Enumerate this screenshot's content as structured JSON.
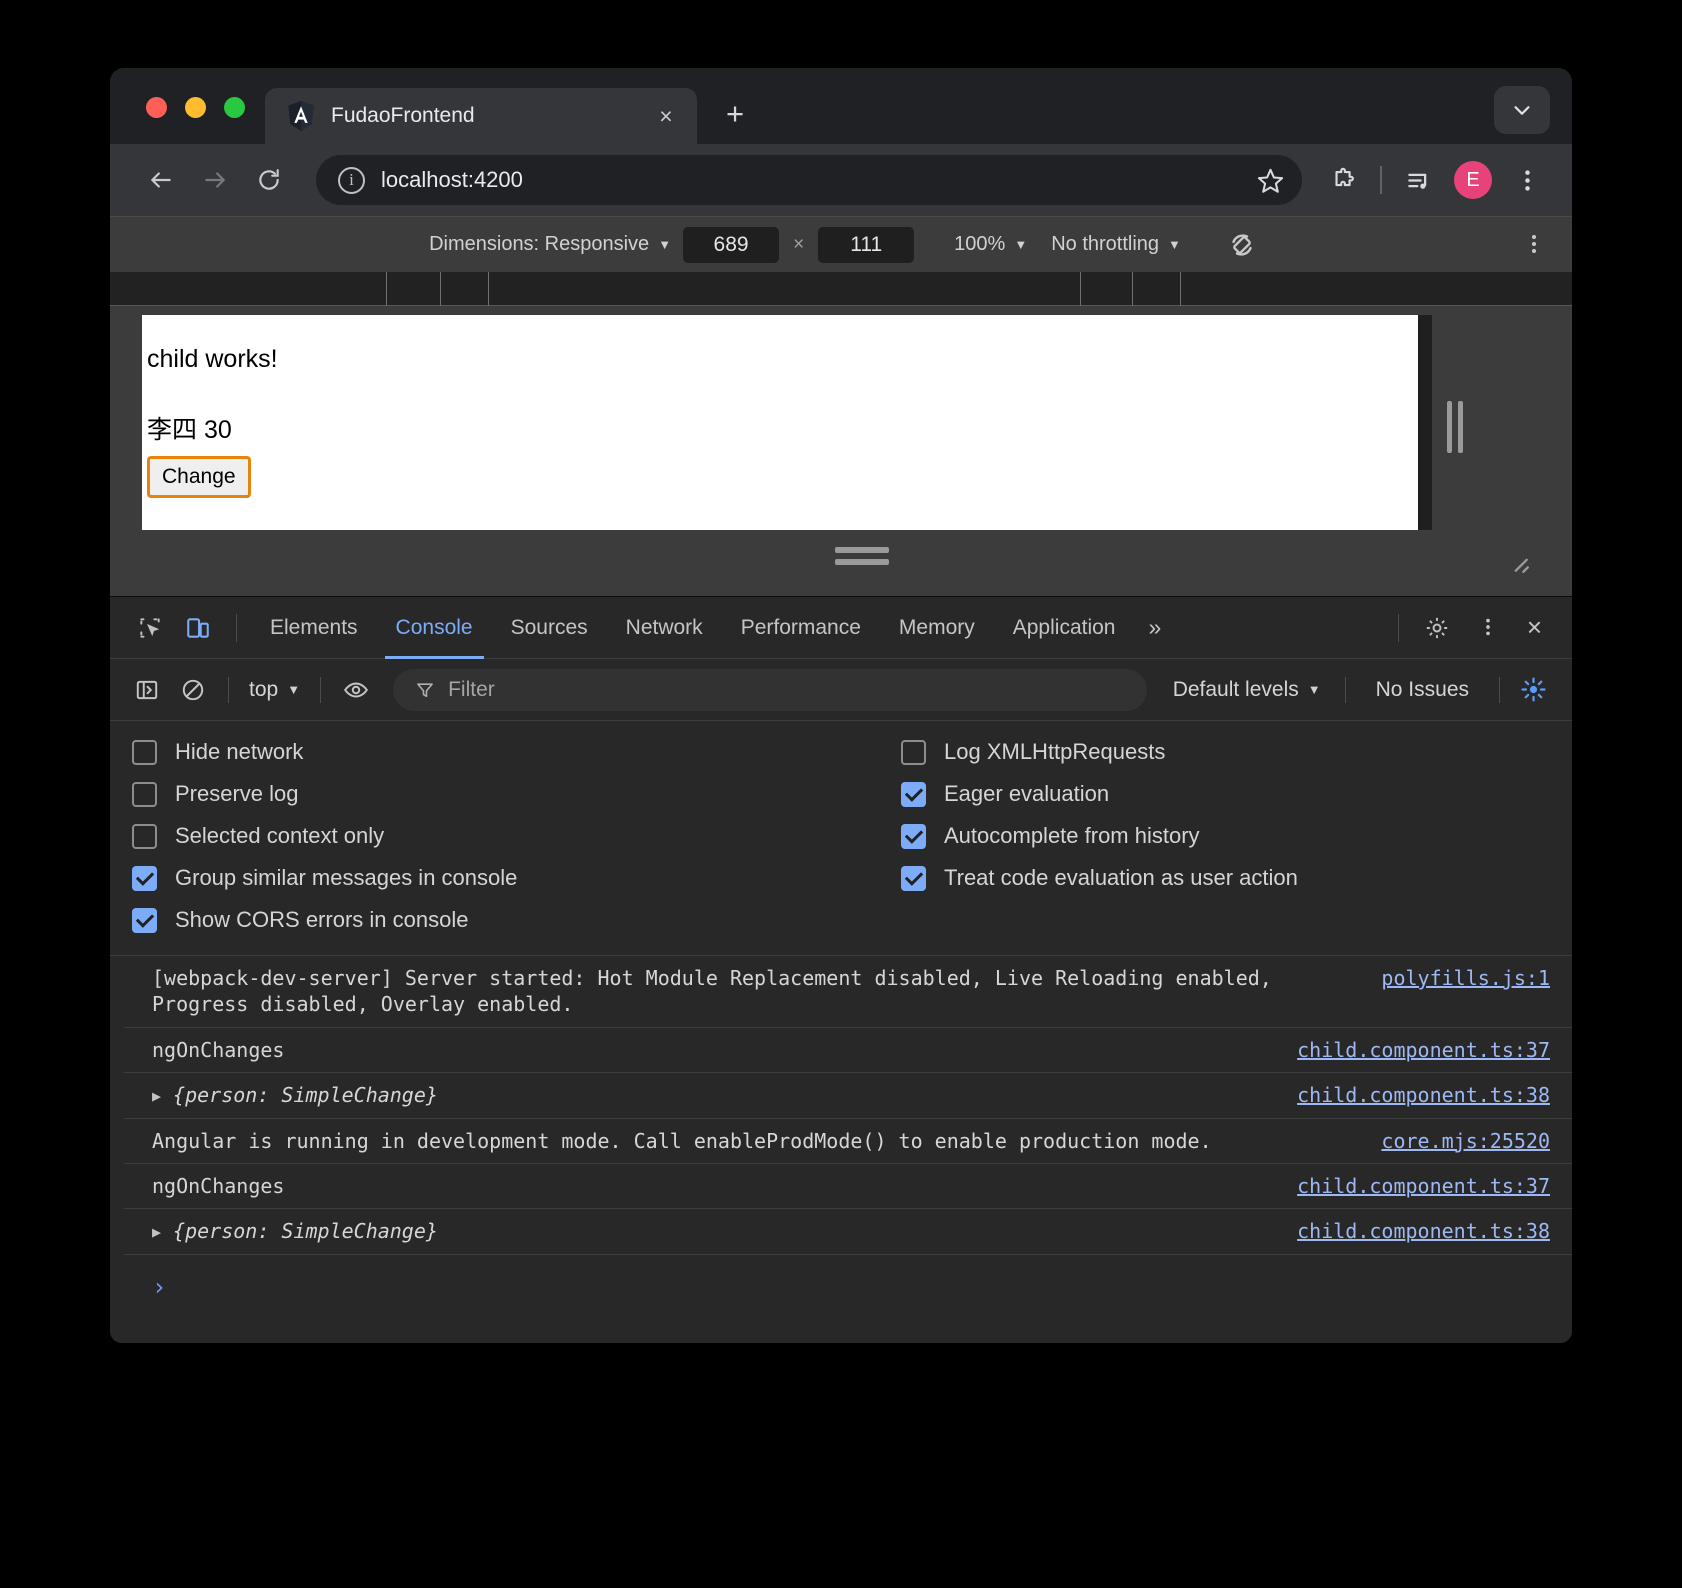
{
  "browser": {
    "tab": {
      "title": "FudaoFrontend",
      "favicon": "angular-logo-icon",
      "close_label": "×"
    },
    "new_tab_label": "+",
    "tab_list_caret": "chevron-down-icon",
    "nav": {
      "back": "back-arrow-icon",
      "forward": "forward-arrow-icon",
      "reload": "reload-icon",
      "site_info": "i",
      "url": "localhost:4200",
      "bookmark": "star-icon",
      "extensions": "puzzle-icon",
      "media": "media-playlist-icon",
      "profile_initial": "E",
      "menu": "kebab-menu-icon"
    }
  },
  "device_toolbar": {
    "dimensions_label": "Dimensions: Responsive",
    "width": "689",
    "height": "111",
    "x_separator": "×",
    "zoom": "100%",
    "throttling": "No throttling",
    "rotate": "rotate-device-icon",
    "more": "kebab-menu-icon"
  },
  "page": {
    "heading": "child works!",
    "person_line": "李四 30",
    "change_button": "Change"
  },
  "devtools": {
    "tabs": [
      {
        "label": "Elements",
        "active": false
      },
      {
        "label": "Console",
        "active": true
      },
      {
        "label": "Sources",
        "active": false
      },
      {
        "label": "Network",
        "active": false
      },
      {
        "label": "Performance",
        "active": false
      },
      {
        "label": "Memory",
        "active": false
      },
      {
        "label": "Application",
        "active": false
      }
    ],
    "overflow_label": "»",
    "settings_icon": "gear-icon",
    "more_icon": "kebab-menu-icon",
    "close_icon": "×",
    "filterbar": {
      "sidebar_toggle": "sidebar-toggle-icon",
      "clear_console": "clear-console-icon",
      "context": "top",
      "live_expression": "eye-icon",
      "filter_placeholder": "Filter",
      "levels": "Default levels",
      "issues": "No Issues",
      "settings_gear": "gear-icon"
    },
    "settings_left": [
      {
        "label": "Hide network",
        "checked": false
      },
      {
        "label": "Preserve log",
        "checked": false
      },
      {
        "label": "Selected context only",
        "checked": false
      },
      {
        "label": "Group similar messages in console",
        "checked": true
      },
      {
        "label": "Show CORS errors in console",
        "checked": true
      }
    ],
    "settings_right": [
      {
        "label": "Log XMLHttpRequests",
        "checked": false
      },
      {
        "label": "Eager evaluation",
        "checked": true
      },
      {
        "label": "Autocomplete from history",
        "checked": true
      },
      {
        "label": "Treat code evaluation as user action",
        "checked": true
      }
    ],
    "messages": [
      {
        "text": "[webpack-dev-server] Server started: Hot Module Replacement disabled, Live Reloading enabled, Progress disabled, Overlay enabled.",
        "source": "polyfills.js:1",
        "expandable": false
      },
      {
        "text": "ngOnChanges",
        "source": "child.component.ts:37",
        "expandable": false
      },
      {
        "text": "{person: SimpleChange}",
        "source": "child.component.ts:38",
        "expandable": true
      },
      {
        "text": "Angular is running in development mode. Call enableProdMode() to enable production mode.",
        "source": "core.mjs:25520",
        "expandable": false
      },
      {
        "text": "ngOnChanges",
        "source": "child.component.ts:37",
        "expandable": false
      },
      {
        "text": "{person: SimpleChange}",
        "source": "child.component.ts:38",
        "expandable": true
      }
    ],
    "prompt": "›"
  },
  "colors": {
    "accent_blue": "#7cacf8",
    "avatar_pink": "#e8427a",
    "focus_orange": "#e8840c",
    "link_blue": "#9db8f2"
  }
}
